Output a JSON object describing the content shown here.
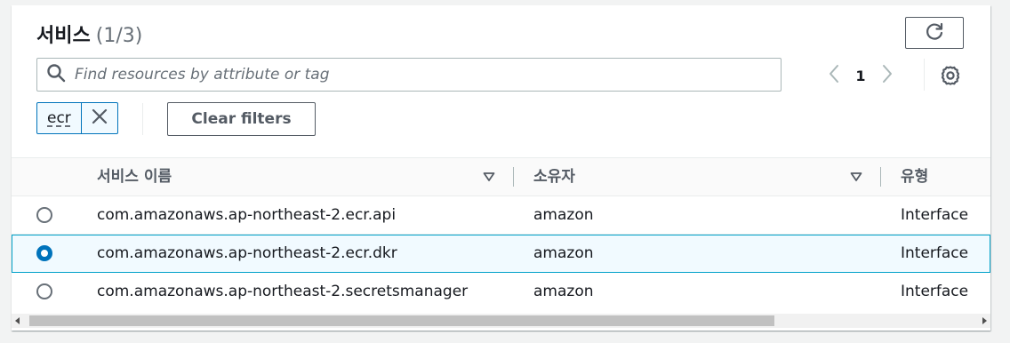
{
  "header": {
    "title": "서비스",
    "count": "(1/3)"
  },
  "search": {
    "placeholder": "Find resources by attribute or tag",
    "value": ""
  },
  "pagination": {
    "current_page": "1"
  },
  "filters": {
    "tokens": [
      "ecr"
    ],
    "clear_label": "Clear filters"
  },
  "table": {
    "columns": [
      "서비스 이름",
      "소유자",
      "유형"
    ],
    "rows": [
      {
        "service_name": "com.amazonaws.ap-northeast-2.ecr.api",
        "owner": "amazon",
        "type": "Interface",
        "selected": false
      },
      {
        "service_name": "com.amazonaws.ap-northeast-2.ecr.dkr",
        "owner": "amazon",
        "type": "Interface",
        "selected": true
      },
      {
        "service_name": "com.amazonaws.ap-northeast-2.secretsmanager",
        "owner": "amazon",
        "type": "Interface",
        "selected": false
      }
    ]
  },
  "icons": {
    "refresh": "refresh-icon",
    "search": "search-icon",
    "prev": "chevron-left-icon",
    "next": "chevron-right-icon",
    "settings": "gear-icon",
    "remove": "close-icon",
    "sort": "caret-down-icon"
  },
  "colors": {
    "accent": "#0073bb",
    "selected_row_bg": "#f1faff",
    "selected_row_border": "#00a1c9"
  }
}
